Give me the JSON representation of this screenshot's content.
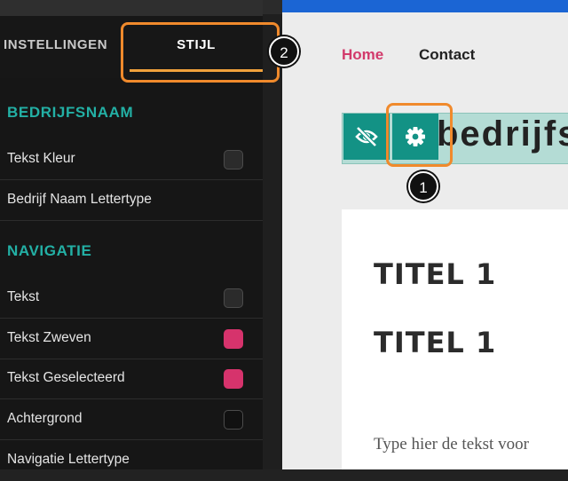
{
  "tabs": {
    "instellingen": "INSTELLINGEN",
    "stijl": "STIJL"
  },
  "sections": {
    "bedrijfsnaam": {
      "title": "BEDRIJFSNAAM",
      "items": [
        {
          "label": "Tekst Kleur",
          "swatch": "#2b2b2b"
        },
        {
          "label": "Bedrijf Naam Lettertype"
        }
      ]
    },
    "navigatie": {
      "title": "NAVIGATIE",
      "items": [
        {
          "label": "Tekst",
          "swatch": "#2b2b2b"
        },
        {
          "label": "Tekst Zweven",
          "swatch": "#d6336c"
        },
        {
          "label": "Tekst Geselecteerd",
          "swatch": "#d6336c"
        },
        {
          "label": "Achtergrond",
          "swatch": "#111111"
        },
        {
          "label": "Navigatie Lettertype"
        }
      ]
    }
  },
  "preview": {
    "nav": {
      "home": "Home",
      "contact": "Contact"
    },
    "brand_text": "bedrijfsnaam",
    "titles": [
      "TITEL 1",
      "TITEL 1"
    ],
    "body_text": "Type hier de tekst voor"
  },
  "callouts": {
    "one": "1",
    "two": "2"
  },
  "colors": {
    "accent_teal": "#23b0a5",
    "highlight_orange": "#f08a2c",
    "nav_active": "#d23a6b"
  }
}
